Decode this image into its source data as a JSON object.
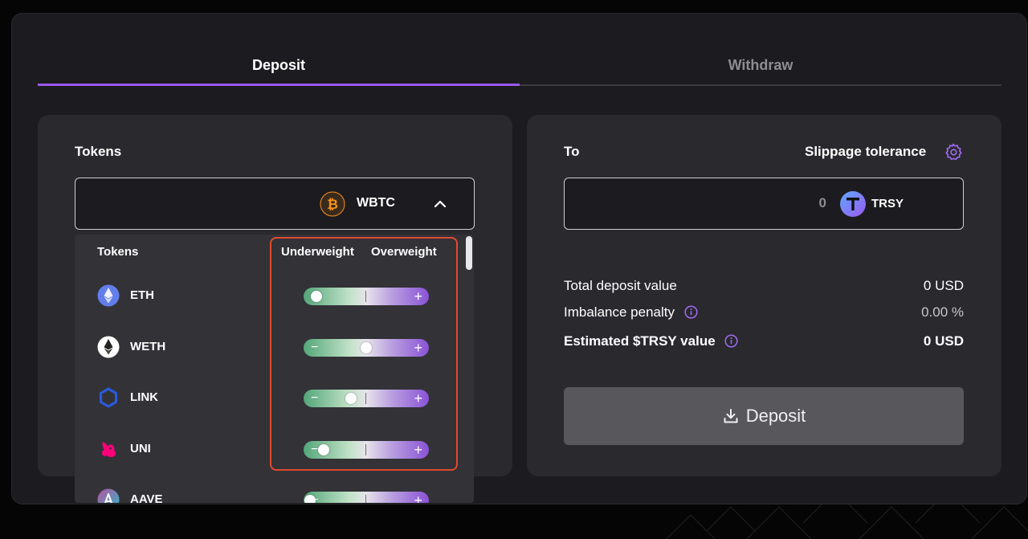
{
  "tabs": {
    "deposit": "Deposit",
    "withdraw": "Withdraw"
  },
  "left_card": {
    "title": "Tokens",
    "selected_token": {
      "symbol": "WBTC",
      "icon": "bitcoin-icon"
    }
  },
  "dropdown": {
    "col_tokens": "Tokens",
    "col_underweight": "Underweight",
    "col_overweight": "Overweight",
    "rows": [
      {
        "symbol": "ETH",
        "icon": "ethereum-icon",
        "weight_level": 0.1
      },
      {
        "symbol": "WETH",
        "icon": "weth-icon",
        "weight_level": 0.5
      },
      {
        "symbol": "LINK",
        "icon": "chainlink-icon",
        "weight_level": 0.38
      },
      {
        "symbol": "UNI",
        "icon": "uniswap-icon",
        "weight_level": 0.16
      },
      {
        "symbol": "AAVE",
        "icon": "aave-icon",
        "weight_level": 0.05
      }
    ]
  },
  "right_card": {
    "to_label": "To",
    "slippage_label": "Slippage tolerance",
    "amount": "0",
    "to_token": "TRSY",
    "total_label": "Total deposit value",
    "total_value": "0 USD",
    "penalty_label": "Imbalance penalty",
    "penalty_value": "0.00 %",
    "estimated_label": "Estimated $TRSY value",
    "estimated_value": "0 USD",
    "deposit_button": "Deposit"
  },
  "colors": {
    "accent": "#9b59f2",
    "highlight": "#e04a2f",
    "button": "#58575c"
  }
}
